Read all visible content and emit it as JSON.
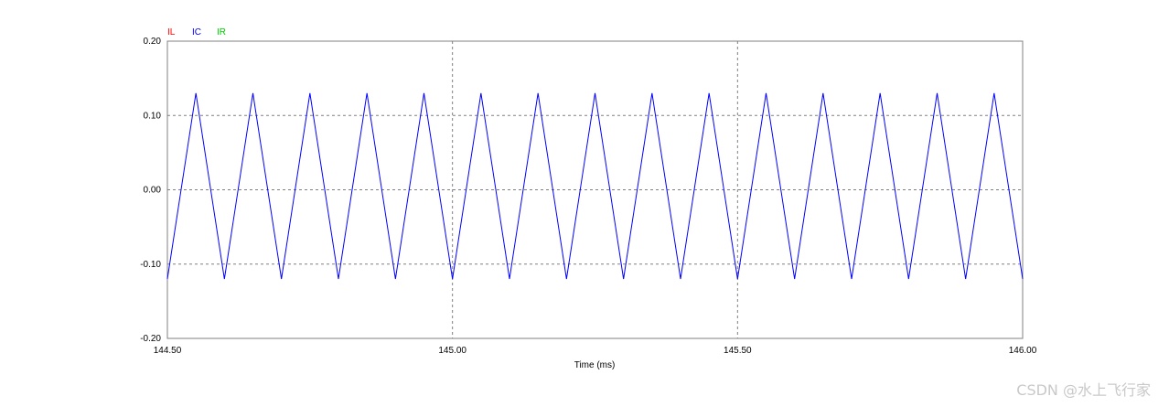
{
  "chart_data": {
    "type": "line",
    "title": "",
    "xlabel": "Time  (ms)",
    "ylabel": "",
    "xlim": [
      144.5,
      146.0
    ],
    "ylim": [
      -0.2,
      0.2
    ],
    "xticks": [
      "144.50",
      "145.00",
      "145.50",
      "146.00"
    ],
    "yticks": [
      "0.20",
      "0.10",
      "0.00",
      "-0.10",
      "-0.20"
    ],
    "grid": "dashed",
    "legend_position": "top-left",
    "legend": [
      {
        "name": "IL",
        "color": "#ff0000"
      },
      {
        "name": "IC",
        "color": "#0000ff"
      },
      {
        "name": "IR",
        "color": "#00cc00"
      }
    ],
    "series": [
      {
        "name": "IC",
        "color": "#0000ff",
        "x": [
          144.5,
          144.55,
          144.6,
          144.65,
          144.7,
          144.75,
          144.8,
          144.85,
          144.9,
          144.95,
          145.0,
          145.05,
          145.1,
          145.15,
          145.2,
          145.25,
          145.3,
          145.35,
          145.4,
          145.45,
          145.5,
          145.55,
          145.6,
          145.65,
          145.7,
          145.75,
          145.8,
          145.85,
          145.9,
          145.95,
          146.0
        ],
        "y": [
          -0.12,
          0.13,
          -0.12,
          0.13,
          -0.12,
          0.13,
          -0.12,
          0.13,
          -0.12,
          0.13,
          -0.12,
          0.13,
          -0.12,
          0.13,
          -0.12,
          0.13,
          -0.12,
          0.13,
          -0.12,
          0.13,
          -0.12,
          0.13,
          -0.12,
          0.13,
          -0.12,
          0.13,
          -0.12,
          0.13,
          -0.12,
          0.13,
          -0.12
        ]
      }
    ]
  },
  "watermark": "CSDN @水上飞行家"
}
